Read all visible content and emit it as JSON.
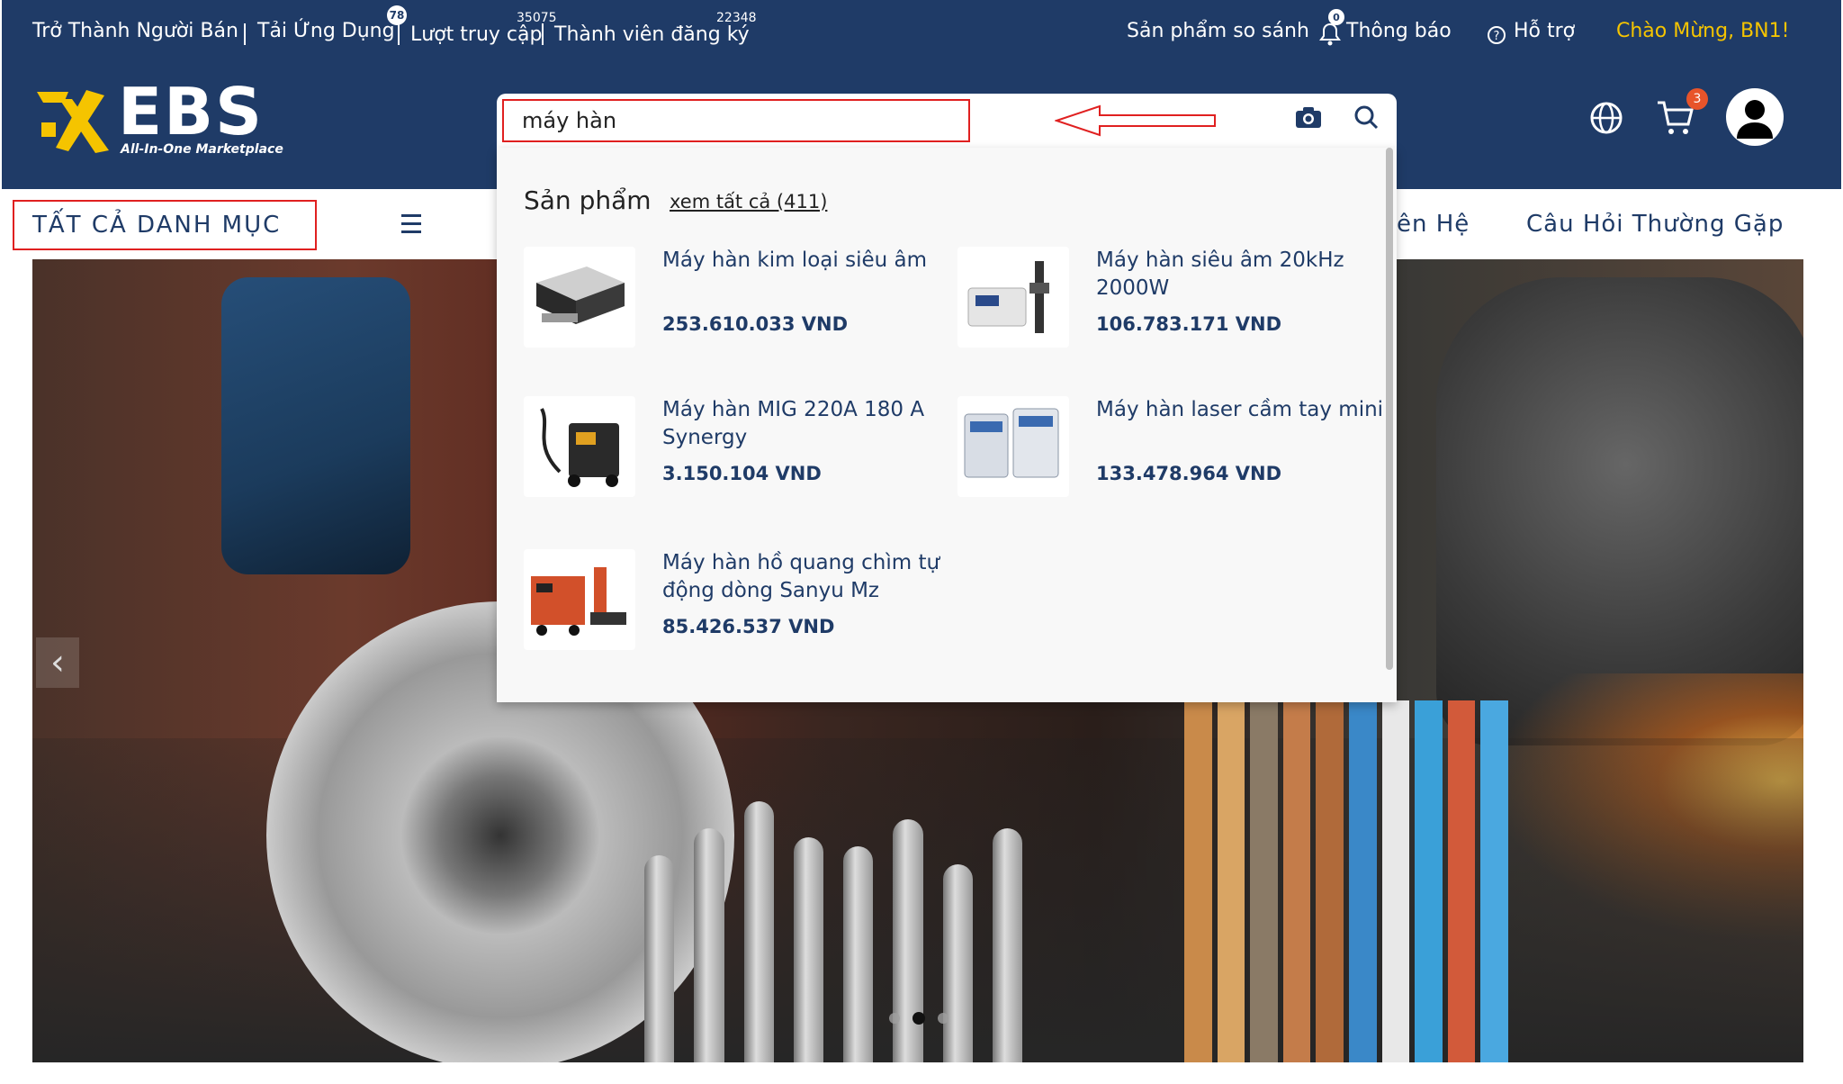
{
  "header": {
    "links": {
      "become_seller": "Trở Thành Người Bán",
      "download_app": "Tải Ứng Dụng",
      "visits": "Lượt truy cập",
      "members": "Thành viên đăng ký",
      "compare": "Sản phẩm so sánh",
      "notifications": "Thông báo",
      "support": "Hỗ trợ",
      "welcome": "Chào Mừng, BN1!"
    },
    "counters": {
      "app_badge": "78",
      "visits_count": "35075",
      "members_count": "22348",
      "notifications_count": "0"
    },
    "logo": {
      "text": "EBS",
      "tagline": "All-In-One Marketplace"
    },
    "cart_count": "3"
  },
  "search": {
    "query": "máy hàn",
    "dropdown": {
      "section_title": "Sản phẩm",
      "see_all": "xem tất cả (411)",
      "products": [
        {
          "name": "Máy hàn kim loại siêu âm",
          "price": "253.610.033 VND"
        },
        {
          "name": "Máy hàn siêu âm 20kHz 2000W",
          "price": "106.783.171 VND"
        },
        {
          "name": "Máy hàn MIG 220A 180 A Synergy",
          "price": "3.150.104 VND"
        },
        {
          "name": "Máy hàn laser cầm tay mini",
          "price": "133.478.964 VND"
        },
        {
          "name": "Máy hàn hồ quang chìm tự động dòng Sanyu Mz",
          "price": "85.426.537 VND"
        }
      ]
    }
  },
  "nav": {
    "all_categories": "TẤT CẢ DANH MỤC",
    "contact_partial": "ên Hệ",
    "faq": "Câu Hỏi Thường Gặp"
  },
  "colors": {
    "brand_navy": "#1f3b67",
    "accent_yellow": "#f5c400",
    "highlight_red": "#e02020",
    "cart_badge": "#e8542a"
  }
}
